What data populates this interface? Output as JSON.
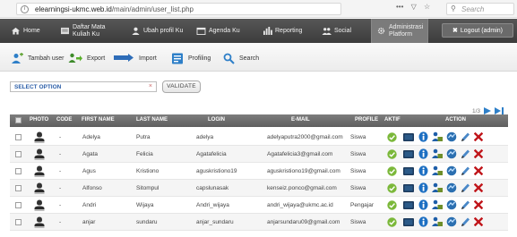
{
  "browser": {
    "info_icon": "info-icon",
    "url_domain": "elearningsi-ukmc.web.id",
    "url_path": "/main/admin/user_list.php",
    "actions": [
      "•••",
      "▽",
      "☆"
    ],
    "search_placeholder": "Search"
  },
  "nav": {
    "items": [
      {
        "label": "Home",
        "icon": "house-icon"
      },
      {
        "label": "Daftar Mata\nKuliah Ku",
        "icon": "courses-icon"
      },
      {
        "label": "Ubah profil Ku",
        "icon": "user-icon"
      },
      {
        "label": "Agenda Ku",
        "icon": "calendar-icon"
      },
      {
        "label": "Reporting",
        "icon": "bar-chart-icon"
      },
      {
        "label": "Social",
        "icon": "people-icon"
      },
      {
        "label": "Administrasi\nPlatform",
        "icon": "gear-icon"
      }
    ],
    "logout_label": "Logout (admin)",
    "logout_icon": "close-icon"
  },
  "toolbar": {
    "add_user": "Tambah user",
    "export": "Export",
    "import": "Import",
    "profiling": "Profiling",
    "search": "Search"
  },
  "filter": {
    "select_value": "SELECT OPTION",
    "clear_icon": "×",
    "validate_label": "VALIDATE"
  },
  "pager": {
    "text": "1/3",
    "next_icon": "▶",
    "last_icon": "▶|"
  },
  "table": {
    "headers": {
      "photo": "PHOTO",
      "code": "CODE",
      "first_name": "FIRST NAME",
      "last_name": "LAST NAME",
      "login": "LOGIN",
      "email": "E-MAIL",
      "profile": "PROFILE",
      "active": "AKTIF",
      "action": "ACTION"
    },
    "rows": [
      {
        "code": "-",
        "first_name": "Adelya",
        "last_name": "Putra",
        "login": "adelya",
        "email": "adelyaputra2000@gmail.com",
        "profile": "Siswa"
      },
      {
        "code": "-",
        "first_name": "Agata",
        "last_name": "Felicia",
        "login": "Agatafelicia",
        "email": "Agatafelicia3@gmail.com",
        "profile": "Siswa"
      },
      {
        "code": "-",
        "first_name": "Agus",
        "last_name": "Kristiono",
        "login": "aguskristiono19",
        "email": "aguskristiono19@gmail.com",
        "profile": "Siswa"
      },
      {
        "code": "-",
        "first_name": "Alfonso",
        "last_name": "Sitompul",
        "login": "capslunasak",
        "email": "kenseiz.ponco@gmail.com",
        "profile": "Siswa"
      },
      {
        "code": "-",
        "first_name": "Andri",
        "last_name": "Wijaya",
        "login": "Andri_wijaya",
        "email": "andri_wijaya@ukmc.ac.id",
        "profile": "Pengajar"
      },
      {
        "code": "-",
        "first_name": "anjar",
        "last_name": "sundaru",
        "login": "anjar_sundaru",
        "email": "anjarsundaru09@gmail.com",
        "profile": "Siswa"
      }
    ],
    "action_icons": [
      "info-icon",
      "group-icon",
      "reports-icon",
      "edit-icon",
      "delete-icon"
    ]
  },
  "colors": {
    "nav_bg": "#474747",
    "header_bg": "#6d6d6d",
    "active_green": "#7bb83a",
    "delete_red": "#c0161b",
    "link_blue": "#2d5fa8"
  }
}
